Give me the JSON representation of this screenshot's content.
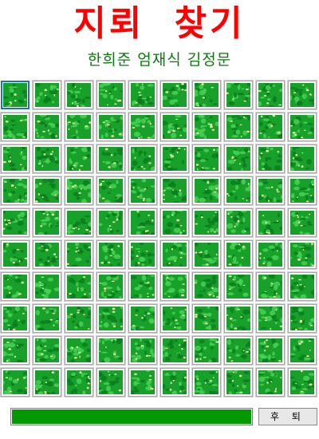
{
  "header": {
    "title": "지뢰 찾기",
    "subtitle": "한희준 엄재식 김정문"
  },
  "board": {
    "rows": 10,
    "cols": 10,
    "selected": {
      "row": 0,
      "col": 0
    },
    "tile_icon": "grass-tile-icon",
    "colors": {
      "tile_base": "#18a12a",
      "tile_dark": "#0c7d1e",
      "tile_light": "#49d153",
      "tile_speck": "#f2f0a4",
      "selected_border": "#1a75b8"
    }
  },
  "footer": {
    "progress": 1.0,
    "progress_color": "#009a00",
    "back_label": "후 퇴"
  }
}
